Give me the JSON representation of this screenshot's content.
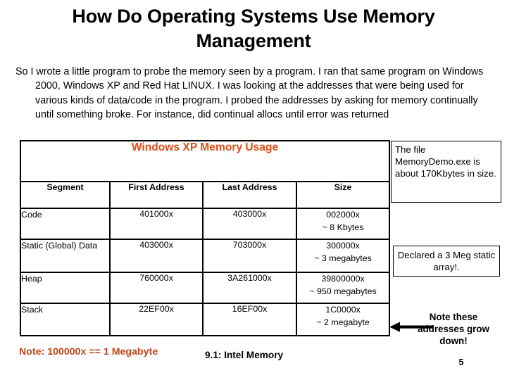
{
  "slide": {
    "title": "How Do Operating Systems Use Memory Management",
    "body": "So I wrote a little program to probe the memory seen by a program.  I ran that same program on Windows 2000, Windows XP and Red Hat LINUX.  I was looking at the addresses that were being used for various kinds of data/code in the program.  I probed the addresses by asking for memory continually until something broke.  For instance, did continual allocs until error was returned",
    "number": "5",
    "footer_label": "9.1: Intel Memory"
  },
  "table": {
    "title": "Windows XP Memory Usage",
    "title_color": "#DD4E1A",
    "columns": [
      "Segment",
      "First Address",
      "Last Address",
      "Size"
    ],
    "rows": [
      {
        "segment": "Code",
        "first_address": "401000x",
        "last_address": "403000x",
        "size": "002000x",
        "size_approx": "~ 8 Kbytes"
      },
      {
        "segment": "Static (Global) Data",
        "first_address": "403000x",
        "last_address": "703000x",
        "size": "300000x",
        "size_approx": "~ 3 megabytes"
      },
      {
        "segment": "Heap",
        "first_address": "760000x",
        "last_address": "3A261000x",
        "size": "39800000x",
        "size_approx": "~ 950 megabytes"
      },
      {
        "segment": "Stack",
        "first_address": "22EF00x",
        "last_address": "16EF00x",
        "size": "1C0000x",
        "size_approx": "~ 2 megabyte"
      }
    ]
  },
  "callouts": {
    "file_size": "The file MemoryDemo.exe is about  170Kbytes in size.",
    "static_array": "Declared a 3 Meg static array!.",
    "grow_down": "Note these addresses grow down!"
  },
  "notes": {
    "megabyte": "Note:  100000x == 1 Megabyte",
    "megabyte_color": "#C0441A"
  }
}
